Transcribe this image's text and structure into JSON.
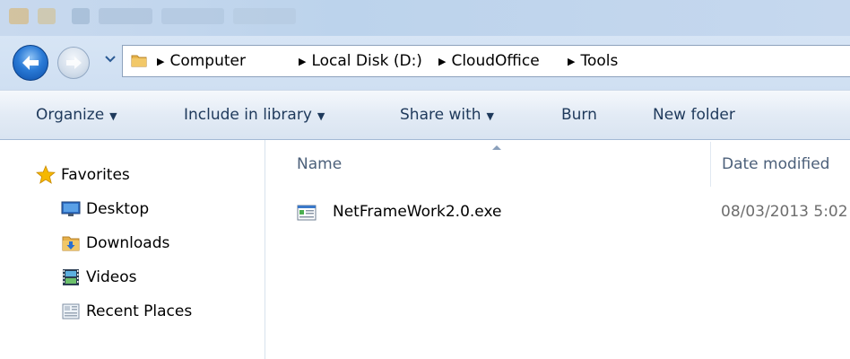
{
  "address": {
    "crumbs": [
      {
        "label": "Computer"
      },
      {
        "label": "Local Disk (D:)"
      },
      {
        "label": "CloudOffice"
      },
      {
        "label": "Tools"
      }
    ]
  },
  "toolbar": {
    "organize": "Organize",
    "include_in_library": "Include in library",
    "share_with": "Share with",
    "burn": "Burn",
    "new_folder": "New folder"
  },
  "nav": {
    "favorites": "Favorites",
    "items": [
      {
        "label": "Desktop",
        "icon": "desktop-icon"
      },
      {
        "label": "Downloads",
        "icon": "downloads-folder-icon"
      },
      {
        "label": "Videos",
        "icon": "videos-icon"
      },
      {
        "label": "Recent Places",
        "icon": "recent-places-icon"
      }
    ]
  },
  "columns": {
    "name": "Name",
    "date_modified": "Date modified"
  },
  "files": [
    {
      "name": "NetFrameWork2.0.exe",
      "date": "08/03/2013 5:02",
      "icon": "exe-file-icon"
    }
  ],
  "colors": {
    "toolbar_text": "#1e395b",
    "header_text": "#4c607a",
    "date_text": "#6d6d6d",
    "favorites_star": "#f5b800"
  }
}
